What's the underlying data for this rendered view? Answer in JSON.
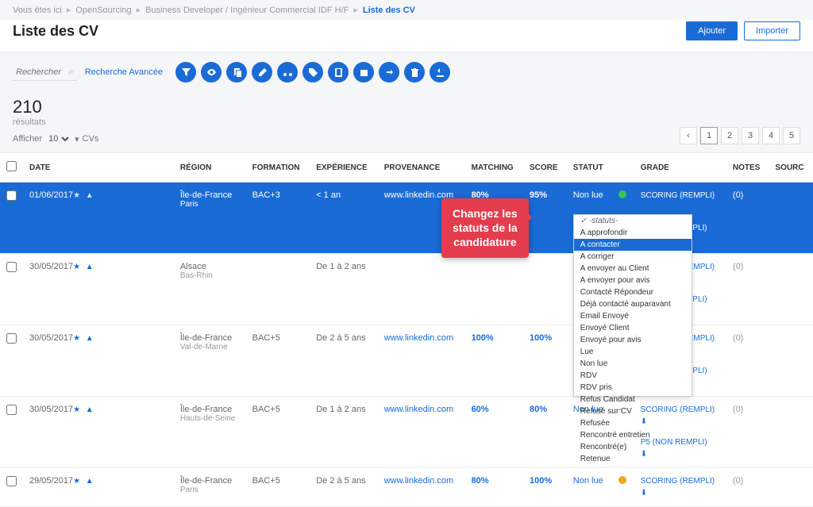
{
  "breadcrumb": {
    "here": "Vous êtes ici",
    "items": [
      "OpenSourcing",
      "Business Developer / Ingénieur Commercial IDF H/F"
    ],
    "current": "Liste des CV"
  },
  "page_title": "Liste des CV",
  "buttons": {
    "add": "Ajouter",
    "import": "Importer"
  },
  "search": {
    "placeholder": "Rechercher",
    "advanced": "Recherche Avancée"
  },
  "toolbar_icons": [
    "filter",
    "eye",
    "copy",
    "edit",
    "cut",
    "tag",
    "phone",
    "calendar",
    "share",
    "delete",
    "download"
  ],
  "results": {
    "count": "210",
    "label": "résultats",
    "show_prefix": "Afficher",
    "show_value": "10",
    "show_suffix": "CVs"
  },
  "pager": {
    "prev": "‹",
    "pages": [
      "1",
      "2",
      "3",
      "4",
      "5"
    ],
    "active": "1"
  },
  "columns": [
    "",
    "DATE",
    "",
    "RÉGION",
    "FORMATION",
    "EXPÉRIENCE",
    "PROVENANCE",
    "MATCHING",
    "SCORE",
    "STATUT",
    "",
    "GRADE",
    "NOTES",
    "SOURC"
  ],
  "rows": [
    {
      "date": "01/06/2017",
      "region": "Île-de-France",
      "region2": "Paris",
      "formation": "BAC+3",
      "exp": "< 1 an",
      "prov": "www.linkedin.com",
      "match": "80%",
      "score": "95%",
      "statut": "Non lue",
      "dot": "green",
      "grade1": "SCORING (REMPLI)",
      "grade2": "P5 (NON REMPLI)",
      "notes": "(0)",
      "hl": true
    },
    {
      "date": "30/05/2017",
      "region": "Alsace",
      "region2": "Bas-Rhin",
      "formation": "",
      "exp": "De 1 à 2 ans",
      "prov": "",
      "match": "",
      "score": "",
      "statut": "",
      "dot": "orange",
      "grade1": "SCORING (REMPLI)",
      "grade2": "P5 (NON REMPLI)",
      "notes": "(0)"
    },
    {
      "date": "30/05/2017",
      "region": "Île-de-France",
      "region2": "Val-de-Marne",
      "formation": "BAC+5",
      "exp": "De 2 à 5 ans",
      "prov": "www.linkedin.com",
      "match": "100%",
      "score": "100%",
      "statut": "",
      "dot": "orange",
      "grade1": "SCORING (REMPLI)",
      "grade2": "P5 (NON REMPLI)",
      "notes": "(0)"
    },
    {
      "date": "30/05/2017",
      "region": "Île-de-France",
      "region2": "Hauts-de-Seine",
      "formation": "BAC+5",
      "exp": "De 1 à 2 ans",
      "prov": "www.linkedin.com",
      "match": "60%",
      "score": "80%",
      "statut": "Non lue",
      "dot": "",
      "grade1": "SCORING (REMPLI)",
      "grade2": "P5 (NON REMPLI)",
      "notes": "(0)"
    },
    {
      "date": "29/05/2017",
      "region": "Île-de-France",
      "region2": "Paris",
      "formation": "BAC+5",
      "exp": "De 2 à 5 ans",
      "prov": "www.linkedin.com",
      "match": "80%",
      "score": "100%",
      "statut": "Non lue",
      "dot": "orange",
      "grade1": "SCORING (REMPLI)",
      "grade2": "",
      "notes": "(0)"
    }
  ],
  "status_dropdown": {
    "header": "-statuts-",
    "options": [
      "A approfondir",
      "A contacter",
      "A corriger",
      "A envoyer au Client",
      "A envoyer pour avis",
      "Contacté Répondeur",
      "Déjà contacté auparavant",
      "Email Envoyé",
      "Envoyé Client",
      "Envoyé pour avis",
      "Lue",
      "Non lue",
      "RDV",
      "RDV pris",
      "Refus Candidat",
      "Refusé sur CV",
      "Refusée",
      "Rencontré entretien",
      "Rencontré(e)",
      "Retenue"
    ],
    "selected": "A contacter"
  },
  "callout": {
    "l1": "Changez les",
    "l2": "statuts de la",
    "l3": "candidature"
  }
}
